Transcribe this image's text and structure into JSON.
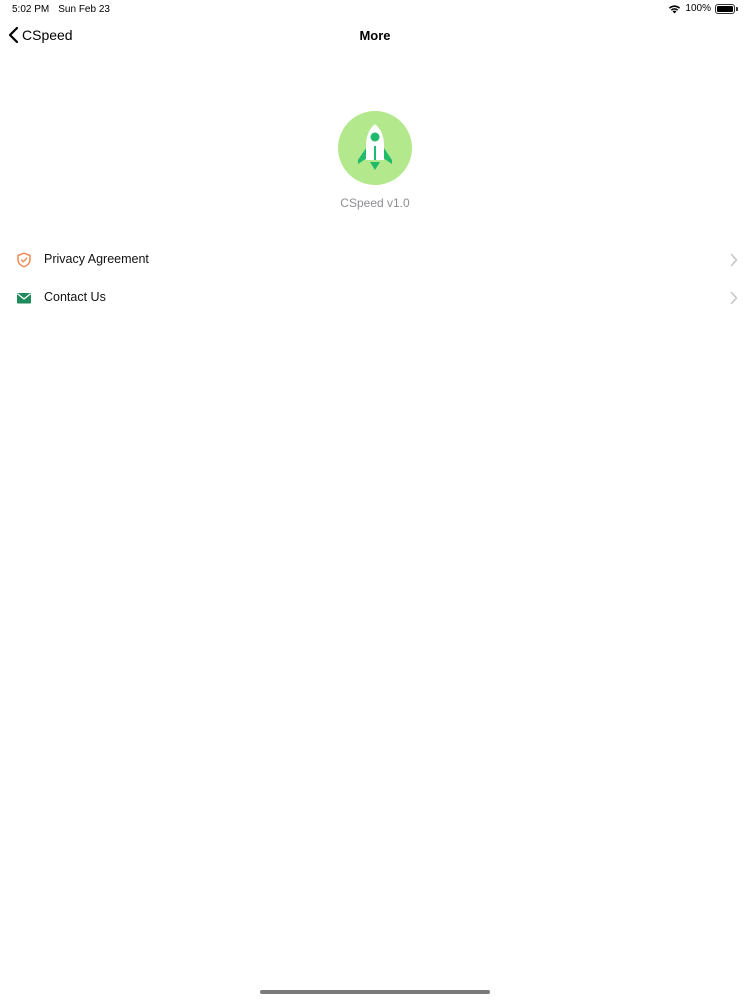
{
  "status_bar": {
    "time": "5:02 PM",
    "date": "Sun Feb 23",
    "battery": "100%",
    "battery_level": 1.0
  },
  "nav": {
    "back_label": "CSpeed",
    "title": "More"
  },
  "app": {
    "version_text": "CSpeed v1.0",
    "logo_icon": "rocket-icon",
    "logo_bg": "#b3e98c",
    "accent": "#1fba6b"
  },
  "menu": {
    "items": [
      {
        "label": "Privacy Agreement",
        "icon": "shield-icon"
      },
      {
        "label": "Contact Us",
        "icon": "envelope-icon"
      }
    ]
  }
}
